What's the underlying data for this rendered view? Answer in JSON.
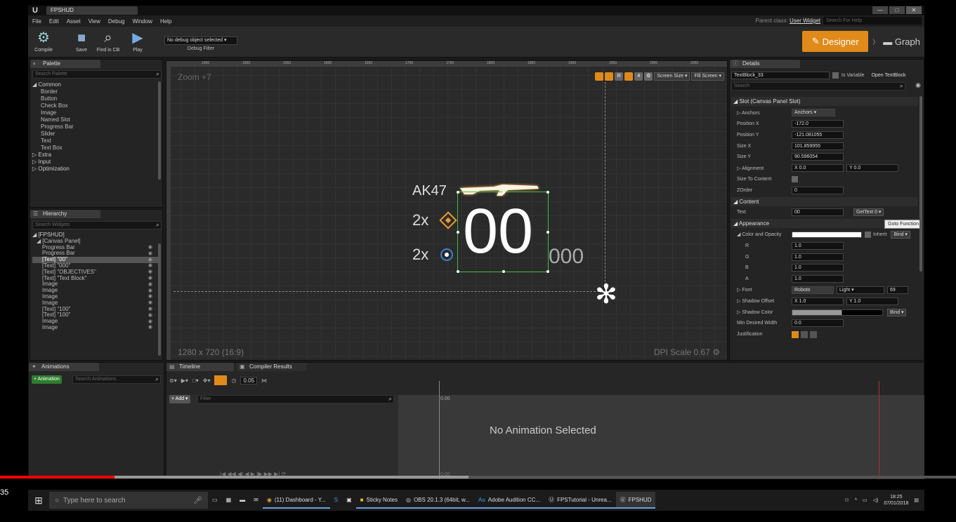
{
  "window": {
    "tab_title": "FPSHUD",
    "min": "—",
    "max": "□",
    "close": "✕"
  },
  "menu": [
    "File",
    "Edit",
    "Asset",
    "View",
    "Debug",
    "Window",
    "Help"
  ],
  "parent_class": {
    "label": "Parent class:",
    "value": "User Widget"
  },
  "help_search_placeholder": "Search For Help",
  "toolbar": {
    "compile": "Compile",
    "save": "Save",
    "find_in_cb": "Find in CB",
    "play": "Play",
    "debug_object": "No debug object selected ▾",
    "debug_filter": "Debug Filter",
    "designer": "Designer",
    "graph": "Graph"
  },
  "palette": {
    "tab": "Palette",
    "search_placeholder": "Search Palette",
    "sections": [
      {
        "name": "◢ Common",
        "items": [
          "Border",
          "Button",
          "Check Box",
          "Image",
          "Named Slot",
          "Progress Bar",
          "Slider",
          "Text",
          "Text Box"
        ]
      },
      {
        "name": "▷ Extra",
        "items": []
      },
      {
        "name": "▷ Input",
        "items": []
      },
      {
        "name": "▷ Optimization",
        "items": []
      }
    ]
  },
  "hierarchy": {
    "tab": "Hierarchy",
    "search_placeholder": "Search Widgets",
    "root": "◢ [FPSHUD]",
    "canvas": "◢ [Canvas Panel]",
    "items": [
      "Progress Bar",
      "Progress Bar",
      "[Text] \"00\"",
      "[Text] \"000\"",
      "[Text] \"OBJECTIVES\"",
      "[Text] \"Text Block\"",
      "Image",
      "Image",
      "Image",
      "Image",
      "[Text] \"100\"",
      "[Text] \"100\"",
      "Image",
      "Image"
    ],
    "selected_index": 2
  },
  "viewport": {
    "zoom": "Zoom +7",
    "resolution": "1280 x 720 (16:9)",
    "dpi": "DPI Scale 0.67",
    "screen_size": "Screen Size ▾",
    "fill_screen": "Fill Screen ▾",
    "r_label": "R",
    "four_label": "4",
    "ruler_ticks": [
      "1450",
      "1500",
      "1550",
      "1600",
      "1650",
      "1700",
      "1750",
      "1800",
      "1850",
      "1900",
      "1950",
      "2000",
      "2050"
    ],
    "hud": {
      "weapon": "AK47",
      "multiplier_a": "2x",
      "multiplier_b": "2x",
      "ammo_big": "00",
      "ammo_small": "000"
    }
  },
  "details": {
    "tab": "Details",
    "widget_name": "TextBlock_33",
    "is_variable": "Is Variable",
    "open_textblock": "Open TextBlock",
    "search_placeholder": "Search",
    "slot_header": "◢ Slot (Canvas Panel Slot)",
    "anchors_label": "▷ Anchors",
    "anchors_value": "Anchors ▾",
    "position_x_label": "Position X",
    "position_x": "-172.0",
    "position_y_label": "Position Y",
    "position_y": "-121.081055",
    "size_x_label": "Size X",
    "size_x": "101.859955",
    "size_y_label": "Size Y",
    "size_y": "90.596054",
    "alignment_label": "▷ Alignment",
    "alignment_x": "X 0.0",
    "alignment_y": "Y 0.0",
    "size_to_content_label": "Size To Content",
    "zorder_label": "ZOrder",
    "zorder": "0",
    "content_header": "◢ Content",
    "text_label": "Text",
    "text_value": "00",
    "get_text": "GetText 0 ▾",
    "tooltip": "Goto Function",
    "appearance_header": "◢ Appearance",
    "color_opacity_label": "◢ Color and Opacity",
    "inherit": "Inherit",
    "bind": "Bind ▾",
    "r_label": "R",
    "g_label": "G",
    "b_label": "B",
    "a_label": "A",
    "r": "1.0",
    "g": "1.0",
    "b": "1.0",
    "a": "1.0",
    "font_label": "▷ Font",
    "font_family": "Roboto",
    "font_style": "Light ▾",
    "font_size": "69",
    "shadow_offset_label": "▷ Shadow Offset",
    "shadow_x": "X 1.0",
    "shadow_y": "Y 1.0",
    "shadow_color_label": "▷ Shadow Color",
    "min_width_label": "Min Desired Width",
    "min_width": "0.0",
    "justification_label": "Justification"
  },
  "animations": {
    "tab": "Animations",
    "add": "+ Animation",
    "search_placeholder": "Search Animations"
  },
  "timeline": {
    "tab_timeline": "Timeline",
    "tab_compiler": "Compiler Results",
    "add_track": "+ Add ▾",
    "filter_placeholder": "Filter",
    "snap": "0.05",
    "time_start": "0.00",
    "time_end": "0.00",
    "empty": "No Animation Selected",
    "transport": "|◀ ◀◀ ◀| ◀ ▶ |▶ ▶▶ ▶| ⟳"
  },
  "video": {
    "time": "35",
    "progress": 0.12,
    "buffered": 0.49
  },
  "taskbar": {
    "search_placeholder": "Type here to search",
    "items": [
      "(11) Dashboard - Y...",
      "Sticky Notes",
      "OBS 20.1.3 (64bit, w...",
      "Adobe Audition CC...",
      "FPSTutorial - Unrea...",
      "FPSHUD"
    ],
    "time": "18:25",
    "date": "07/01/2018"
  },
  "colors": {
    "accent": "#e08a1a",
    "selection": "#3fbf3f",
    "progress": "#ff0000"
  }
}
